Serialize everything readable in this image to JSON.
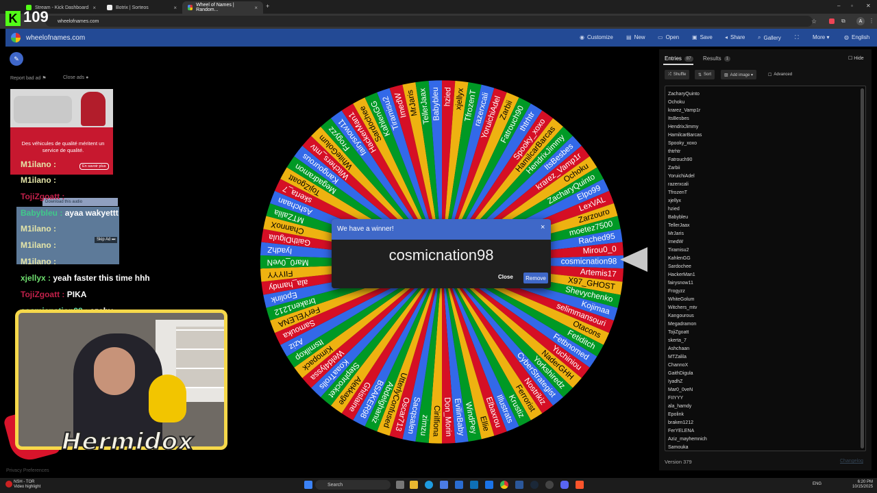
{
  "browser": {
    "tabs": [
      {
        "label": "Stream - Kick Dashboard"
      },
      {
        "label": "Botrix | Sorteos"
      },
      {
        "label": "Wheel of Names | Random..."
      }
    ],
    "url": "wheelofnames.com",
    "new_tab": "+"
  },
  "stream_overlay": {
    "viewer_count": "109",
    "chat": [
      {
        "user": "M1ilano :",
        "msg": "",
        "color": "#e5e5a8"
      },
      {
        "user": "M1ilano :",
        "msg": "",
        "color": "#e5e5a8"
      },
      {
        "user": "TojiZgoatt :",
        "msg": "",
        "color": "#c2204a"
      },
      {
        "user": "Babybleu :",
        "msg": "ayaa wakyettt",
        "color": "#40c98a"
      },
      {
        "user": "M1ilano :",
        "msg": "",
        "color": "#e5e5a8"
      },
      {
        "user": "M1ilano :",
        "msg": "",
        "color": "#e5e5a8"
      },
      {
        "user": "M1ilano :",
        "msg": "",
        "color": "#e5e5a8"
      },
      {
        "user": "xjellyx :",
        "msg": "yeah faster this time hhh",
        "color": "#6fe06f"
      },
      {
        "user": "TojiZgoatt :",
        "msg": "PIKA",
        "color": "#c2204a"
      },
      {
        "user": "cosmicnation98 :",
        "msg": "azeby",
        "color": "#62d8a0"
      }
    ],
    "download_audio": "Download this audio",
    "skip_ad": "Skip Ad ⏭",
    "streamer_name": "Hermidox"
  },
  "site": {
    "name": "wheelofnames.com",
    "nav": [
      {
        "label": "Customize",
        "icon": "palette-icon"
      },
      {
        "label": "New",
        "icon": "file-icon"
      },
      {
        "label": "Open",
        "icon": "folder-icon"
      },
      {
        "label": "Save",
        "icon": "save-icon"
      },
      {
        "label": "Share",
        "icon": "share-icon"
      },
      {
        "label": "Gallery",
        "icon": "search-icon"
      },
      {
        "label": "More ▾",
        "icon": "fullscreen-icon"
      },
      {
        "label": "English",
        "icon": "globe-icon"
      }
    ]
  },
  "ad": {
    "report": "Report bad ad",
    "close": "Close ads",
    "headline": "Des véhicules de qualité méritent un service de qualité.",
    "cta": "En savoir plus"
  },
  "wheel": {
    "names": [
      "cosmicnation98",
      "Artemis17",
      "X97_GHOST",
      "Shevychenko",
      "Kojimaa",
      "selimmansouri",
      "Otacons",
      "Fetiditch",
      "Fetbnomed",
      "Yuchiniou",
      "NaderGHH",
      "Yorkshiredz",
      "CyberStrategist",
      "Nostrikiz",
      "Ferrorist",
      "Krustiz",
      "Illustrats",
      "Elbaxrou",
      "Ellie",
      "WindPey",
      "EvilinBaby",
      "Don_Morin",
      "Cirilfiona",
      "zimzu",
      "Sacqsalen",
      "Oscar713",
      "UtterlyConfused",
      "Abdelghaniz",
      "BSAKER98",
      "Ghislaine",
      "Alekkage",
      "Stephrocket",
      "KoaaTrolls",
      "Weld4lyssa",
      "Kimopack",
      "Itsmilkop",
      "Aziz",
      "Samouka",
      "FerYELENA",
      "braken1212",
      "Epolink",
      "ala_hamdy",
      "FIIYYY",
      "Mar0_0veN",
      "IyadhZ",
      "GaithDigula",
      "ChannoX",
      "MTZalila",
      "Ashchaan",
      "skerta_7",
      "TojiZgoatt",
      "Megadramon",
      "Kangourous",
      "Witchers_mtv",
      "WhiteGolum",
      "Frogyzz",
      "fairysnow11",
      "HackerMan1",
      "Sardochee",
      "KahlenGG",
      "Tiramisu2",
      "ImedW",
      "MrJaris",
      "TellerJaax",
      "Babybleu",
      "hzied",
      "xjellyx",
      "TfrozenT",
      "razerxcali",
      "YoruichiAdel",
      "Zarbii",
      "Fatrouch90",
      "thtrhtr",
      "Spooky_xoxo",
      "HamilcarBarcas",
      "HendrixJimmy",
      "ItsBesbes",
      "krarez_Vamp1r",
      "Ochoku",
      "ZacharyQuinto",
      "Elpo99",
      "LexVAL",
      "Zarzouro",
      "moetez7500",
      "Rached95",
      "Mirou0_0"
    ],
    "colors": [
      "#3369e8",
      "#d50f25",
      "#eeb211",
      "#009925"
    ]
  },
  "dialog": {
    "title": "We have a winner!",
    "winner": "cosmicnation98",
    "close": "Close",
    "remove": "Remove"
  },
  "panel": {
    "tabs": [
      {
        "label": "Entries",
        "count": "87"
      },
      {
        "label": "Results",
        "count": "1"
      }
    ],
    "hide": "Hide",
    "tools": [
      "Shuffle",
      "Sort",
      "Add image ▾",
      "Advanced"
    ],
    "entries": [
      "ZacharyQuinto",
      "Ochoku",
      "krarez_Vamp1r",
      "ItsBesbes",
      "HendrixJimmy",
      "HamilcarBarcas",
      "Spooky_xoxo",
      "thtrhtr",
      "Fatrouch90",
      "Zarbii",
      "YoruichiAdel",
      "razerxcali",
      "TfrozenT",
      "xjellyx",
      "hzied",
      "Babybleu",
      "TellerJaax",
      "MrJaris",
      "ImedW",
      "Tiramisu2",
      "KahlenGG",
      "Sardochee",
      "HackerMan1",
      "fairysnow11",
      "Frogyzz",
      "WhiteGolum",
      "Witchers_mtv",
      "Kangourous",
      "Megadramon",
      "TojiZgoatt",
      "skerta_7",
      "Ashchaan",
      "MTZalila",
      "ChannoX",
      "GaithDigula",
      "IyadhZ",
      "Mar0_0veN",
      "FIIYYY",
      "ala_hamdy",
      "Epolink",
      "braken1212",
      "FerYELENA",
      "Aziz_mayhemnich",
      "Samouka"
    ],
    "version": "Version 379",
    "changelog": "Changelog"
  },
  "taskbar": {
    "weather_line1": "NSH - TOR",
    "weather_line2": "Video highlight",
    "search": "Search",
    "lang": "ENG",
    "time": "6:20 PM",
    "date": "10/15/2025"
  }
}
